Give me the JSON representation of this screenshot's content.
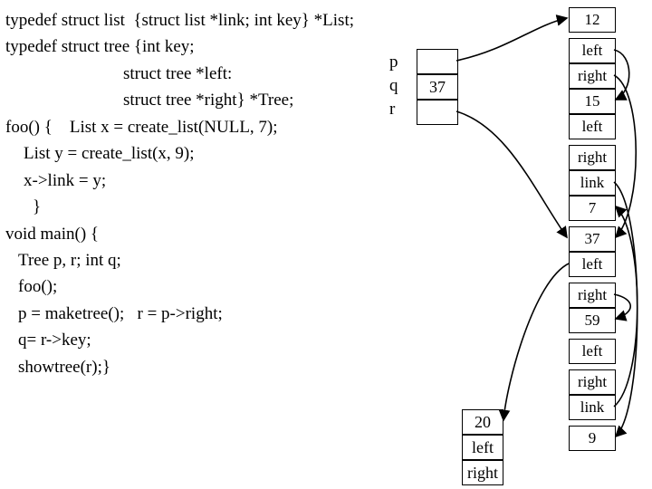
{
  "code": {
    "l1": "typedef struct list  {struct list *link; int key} *List;",
    "l2": "typedef struct tree {int key;",
    "l3": "struct tree *left:",
    "l4": "struct tree *right} *Tree;",
    "l5": "foo() {    List x = create_list(NULL, 7);",
    "l6": "List y = create_list(x, 9);",
    "l7": "x->link = y;",
    "l8": "}",
    "l9": "void main() {",
    "l10": "Tree p, r; int q;",
    "l11": "foo();",
    "l12": "p = maketree();   r = p->right;",
    "l13": "q= r->key;",
    "l14": "showtree(r);}"
  },
  "vars": {
    "p": "p",
    "q": "q",
    "r": "r"
  },
  "boxes": {
    "q_val": "37",
    "node20": {
      "key": "20",
      "left": "left",
      "right": "right"
    },
    "col": {
      "c0": "12",
      "c1": "left",
      "c2": "right",
      "c3": "15",
      "c4": "left",
      "c5": "right",
      "c6": "link",
      "c7": "7",
      "c8": "37",
      "c9": "left",
      "c10": "right",
      "c11": "59",
      "c12": "left",
      "c13": "right",
      "c14": "link",
      "c15": "9"
    }
  }
}
